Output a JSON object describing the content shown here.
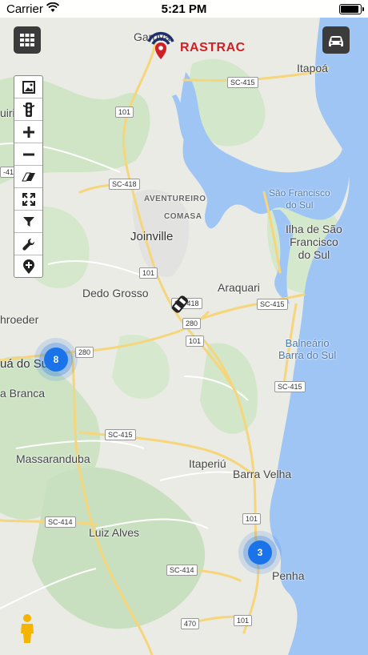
{
  "status_bar": {
    "carrier": "Carrier",
    "time": "5:21 PM"
  },
  "brand": {
    "name": "RASTRAC"
  },
  "toolbar": {
    "items": [
      "image-icon",
      "traffic-light-icon",
      "plus-icon",
      "minus-icon",
      "eraser-icon",
      "expand-icon",
      "filter-icon",
      "wrench-icon",
      "add-location-icon"
    ]
  },
  "map": {
    "places": {
      "garuva": "Garuva",
      "itapoa": "Itapoá",
      "quiriri": "uiriri",
      "aventureiro": "AVENTUREIRO",
      "comasa": "COMASA",
      "joinville": "Joinville",
      "sao_francisco": "São Francisco\ndo Sul",
      "ilha": "Ilha de São\nFrancisco\ndo Sul",
      "dedo_grosso": "Dedo Grosso",
      "araquari": "Araquari",
      "schroeder": "hroeder",
      "guaramirim": "uá do Sul",
      "branca": "a Branca",
      "balneario": "Balneário\nBarra do Sul",
      "massaranduba": "Massaranduba",
      "itaperiu": "Itaperiú",
      "barra_velha": "Barra Velha",
      "luiz_alves": "Luiz Alves",
      "penha": "Penha",
      "left_edge": "-41"
    },
    "roads": {
      "sc415_a": "SC-415",
      "br101_a": "101",
      "sc418": "SC-418",
      "br101_b": "101",
      "sc418_b": "SC-418",
      "sc415_b": "SC-415",
      "br280_a": "280",
      "br101_c": "101",
      "br280_b": "280",
      "sc415_c": "SC-415",
      "sc415_d": "SC-415",
      "sc414_a": "SC-414",
      "br101_d": "101",
      "sc414_b": "SC-414",
      "br470": "470",
      "br101_e": "101"
    },
    "clusters": [
      {
        "count": "8"
      },
      {
        "count": "3"
      }
    ],
    "colors": {
      "land": "#e8eae3",
      "water": "#9fc5f5",
      "green": "#c9e2c1",
      "road": "#f6d57b",
      "cluster": "#1a73e8"
    }
  }
}
